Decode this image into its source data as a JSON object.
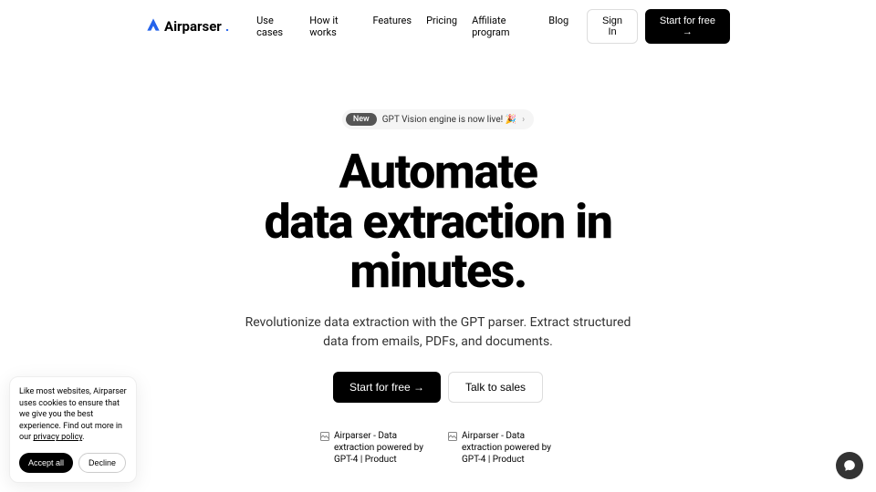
{
  "header": {
    "logo_text": "Airparser",
    "nav": [
      "Use cases",
      "How it works",
      "Features",
      "Pricing",
      "Affiliate program",
      "Blog"
    ],
    "sign_in": "Sign In",
    "start_free": "Start for free →"
  },
  "badge": {
    "new_label": "New",
    "text": "GPT Vision engine is now live! 🎉"
  },
  "hero": {
    "title_line1": "Automate",
    "title_line2": "data extraction in",
    "title_line3": "minutes.",
    "subtitle": "Revolutionize data extraction with the GPT parser. Extract structured data from emails, PDFs, and documents.",
    "cta_primary": "Start for free →",
    "cta_secondary": "Talk to sales"
  },
  "images": {
    "alt1": "Airparser - Data extraction powered by GPT-4 | Product",
    "alt2": "Airparser - Data extraction powered by GPT-4 | Product"
  },
  "cookie": {
    "text_prefix": "Like most websites, Airparser uses cookies to ensure that we give you the best experience. Find out more in our ",
    "link": "privacy policy",
    "text_suffix": ".",
    "accept": "Accept all",
    "decline": "Decline"
  }
}
